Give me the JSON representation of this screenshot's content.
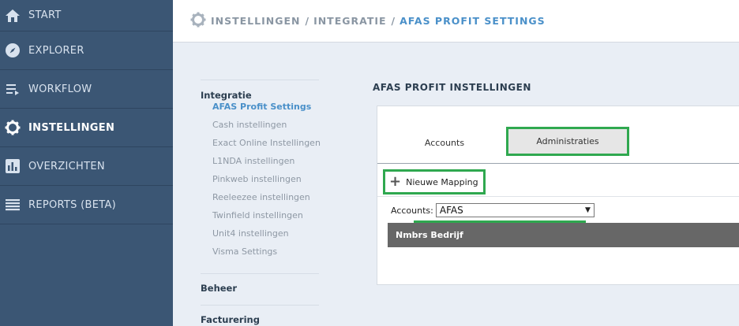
{
  "sidebar": {
    "items": [
      {
        "label": "START",
        "icon": "home-icon"
      },
      {
        "label": "EXPLORER",
        "icon": "compass-icon"
      },
      {
        "label": "WORKFLOW",
        "icon": "workflow-icon"
      },
      {
        "label": "INSTELLINGEN",
        "icon": "gear-icon",
        "active": true
      },
      {
        "label": "OVERZICHTEN",
        "icon": "bar-chart-icon"
      },
      {
        "label": "REPORTS (BETA)",
        "icon": "list-icon"
      }
    ]
  },
  "header": {
    "breadcrumb": [
      "INSTELLINGEN",
      "INTEGRATIE",
      "AFAS PROFIT SETTINGS"
    ],
    "separator": "/"
  },
  "subnav": {
    "groups": [
      {
        "title": "Integratie",
        "items": [
          "AFAS Profit Settings",
          "Cash instellingen",
          "Exact Online Instellingen",
          "L1NDA instellingen",
          "Pinkweb instellingen",
          "Reeleezee instellingen",
          "Twinfield instellingen",
          "Unit4 instellingen",
          "Visma Settings"
        ]
      },
      {
        "title": "Beheer",
        "items": []
      },
      {
        "title": "Facturering",
        "items": []
      }
    ]
  },
  "main": {
    "title": "AFAS PROFIT INSTELLINGEN",
    "tabs": [
      "Accounts",
      "Administraties"
    ],
    "active_tab": "Administraties",
    "new_mapping_label": "Nieuwe Mapping",
    "accounts_label": "Accounts:",
    "accounts_value": "AFAS",
    "table_header": "Nmbrs Bedrijf"
  },
  "colors": {
    "sidebar_bg": "#3b5674",
    "accent_blue": "#4a90c9",
    "highlight_green": "#2fa84f",
    "table_header_bg": "#676767"
  }
}
